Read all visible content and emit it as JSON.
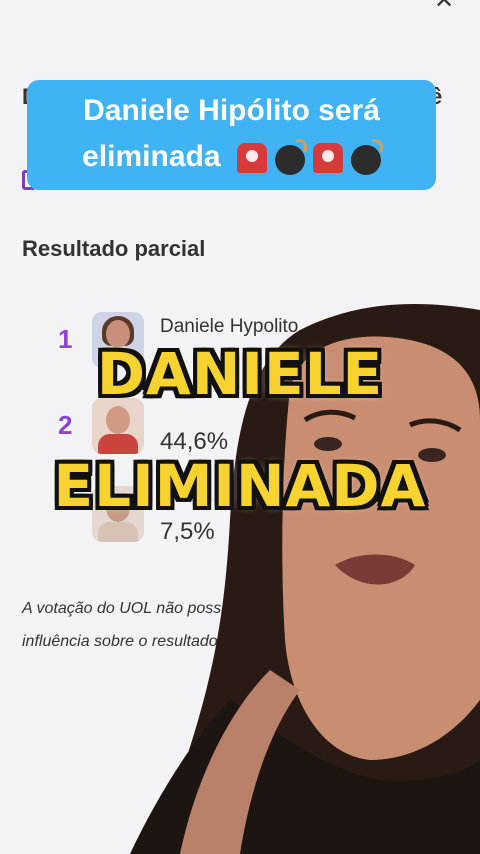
{
  "caption": {
    "line1": "Daniele Hipólito será",
    "line2": "eliminada",
    "emojis": [
      "siren-emoji",
      "bomb-emoji",
      "siren-emoji",
      "bomb-emoji"
    ]
  },
  "poll": {
    "section_title": "Resultado parcial",
    "rows": [
      {
        "rank": "1",
        "name": "Daniele Hypolito"
      },
      {
        "rank": "2",
        "pct": "44,6%"
      },
      {
        "pct": "7,5%"
      }
    ],
    "disclaimer_line1": "A votação do UOL não poss",
    "disclaimer_line2": "influência sobre o resultado"
  },
  "overlay": {
    "line1": "DANIELE",
    "line2": "ELIMINADA"
  },
  "close_label": "✕",
  "colors": {
    "caption_bg": "#40b3f4",
    "rank_purple": "#8a43d6",
    "headline_yellow": "#f7d330"
  }
}
